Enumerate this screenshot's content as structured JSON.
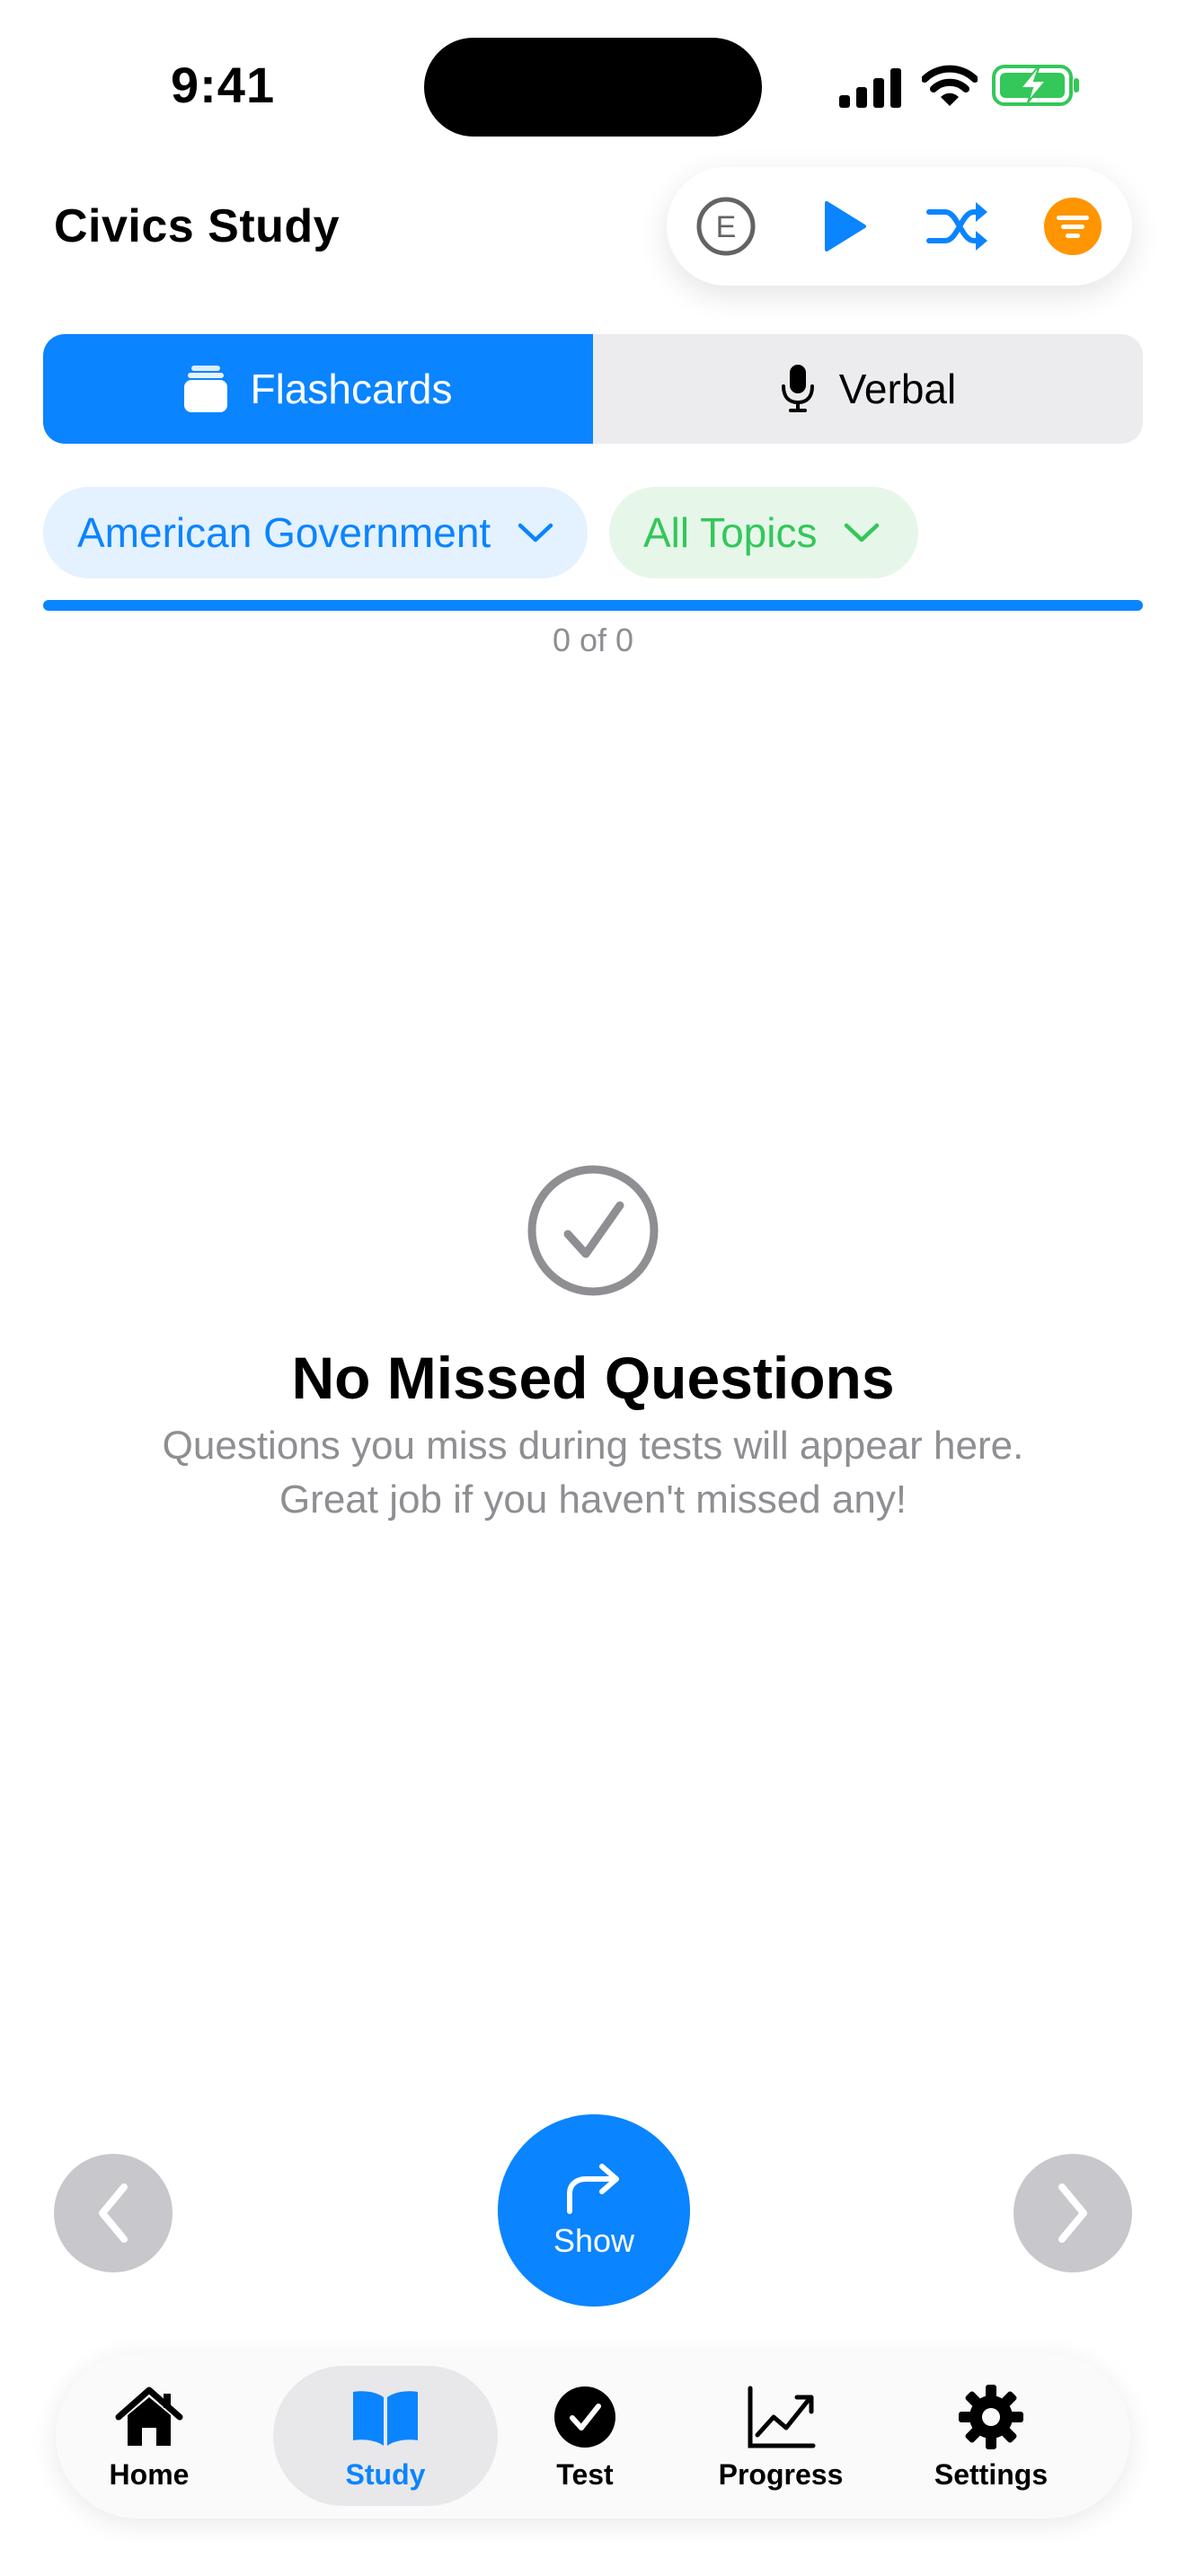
{
  "status_bar": {
    "time": "9:41"
  },
  "header": {
    "title": "Civics Study",
    "toolbar": {
      "icons": [
        "e-circle-icon",
        "play-icon",
        "shuffle-icon",
        "filter-icon"
      ],
      "accent_color": "#0a84ff",
      "filter_color": "#ff9500"
    }
  },
  "mode_tabs": {
    "selected": "Flashcards",
    "items": [
      {
        "label": "Flashcards",
        "icon": "cards-icon"
      },
      {
        "label": "Verbal",
        "icon": "microphone-icon"
      }
    ]
  },
  "filters": {
    "category": "American Government",
    "topic": "All Topics"
  },
  "progress": {
    "label": "0 of 0"
  },
  "empty_state": {
    "icon": "checkmark-circle-icon",
    "title": "No Missed Questions",
    "line1": "Questions you miss during tests will appear here.",
    "line2": "Great job if you haven't missed any!"
  },
  "controls": {
    "show_label": "Show"
  },
  "tab_bar": {
    "selected": "Study",
    "items": [
      {
        "label": "Home",
        "icon": "house-icon"
      },
      {
        "label": "Study",
        "icon": "book-icon"
      },
      {
        "label": "Test",
        "icon": "checkmark-circle-icon"
      },
      {
        "label": "Progress",
        "icon": "chart-icon"
      },
      {
        "label": "Settings",
        "icon": "gear-icon"
      }
    ]
  }
}
